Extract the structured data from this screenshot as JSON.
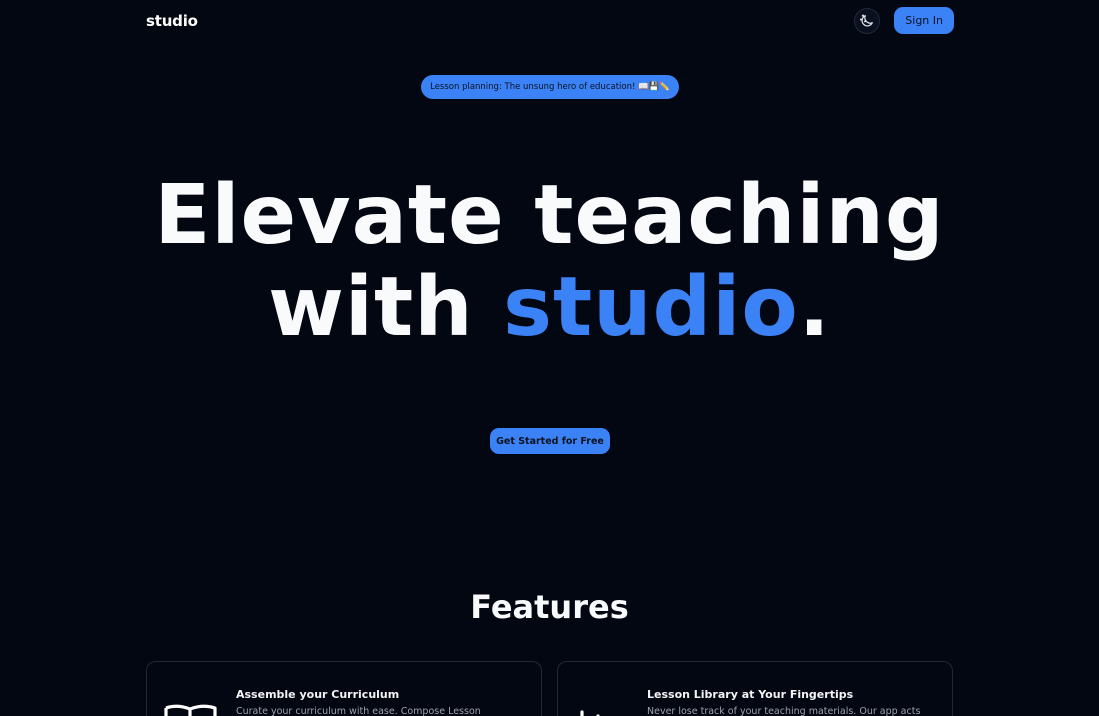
{
  "header": {
    "brand": "studio",
    "theme_toggle_icon": "moon-sparkle-icon",
    "signin_label": "Sign In"
  },
  "announcement": {
    "text": "Lesson planning: The unsung hero of education! 📖💾✏️"
  },
  "hero": {
    "line1": "Elevate teaching",
    "line2_prefix": "with ",
    "line2_accent": "studio",
    "line2_suffix": "."
  },
  "cta": {
    "label": "Get Started for Free"
  },
  "features": {
    "title": "Features",
    "cards": [
      {
        "icon": "book-open-icon",
        "title": "Assemble your Curriculum",
        "description": "Curate your curriculum with ease. Compose Lesson"
      },
      {
        "icon": "library-icon",
        "title": "Lesson Library at Your Fingertips",
        "description": "Never lose track of your teaching materials. Our app acts"
      }
    ]
  },
  "colors": {
    "background": "#030712",
    "accent": "#3b82f6",
    "text": "#f9fafb",
    "muted": "#9ca3af"
  }
}
